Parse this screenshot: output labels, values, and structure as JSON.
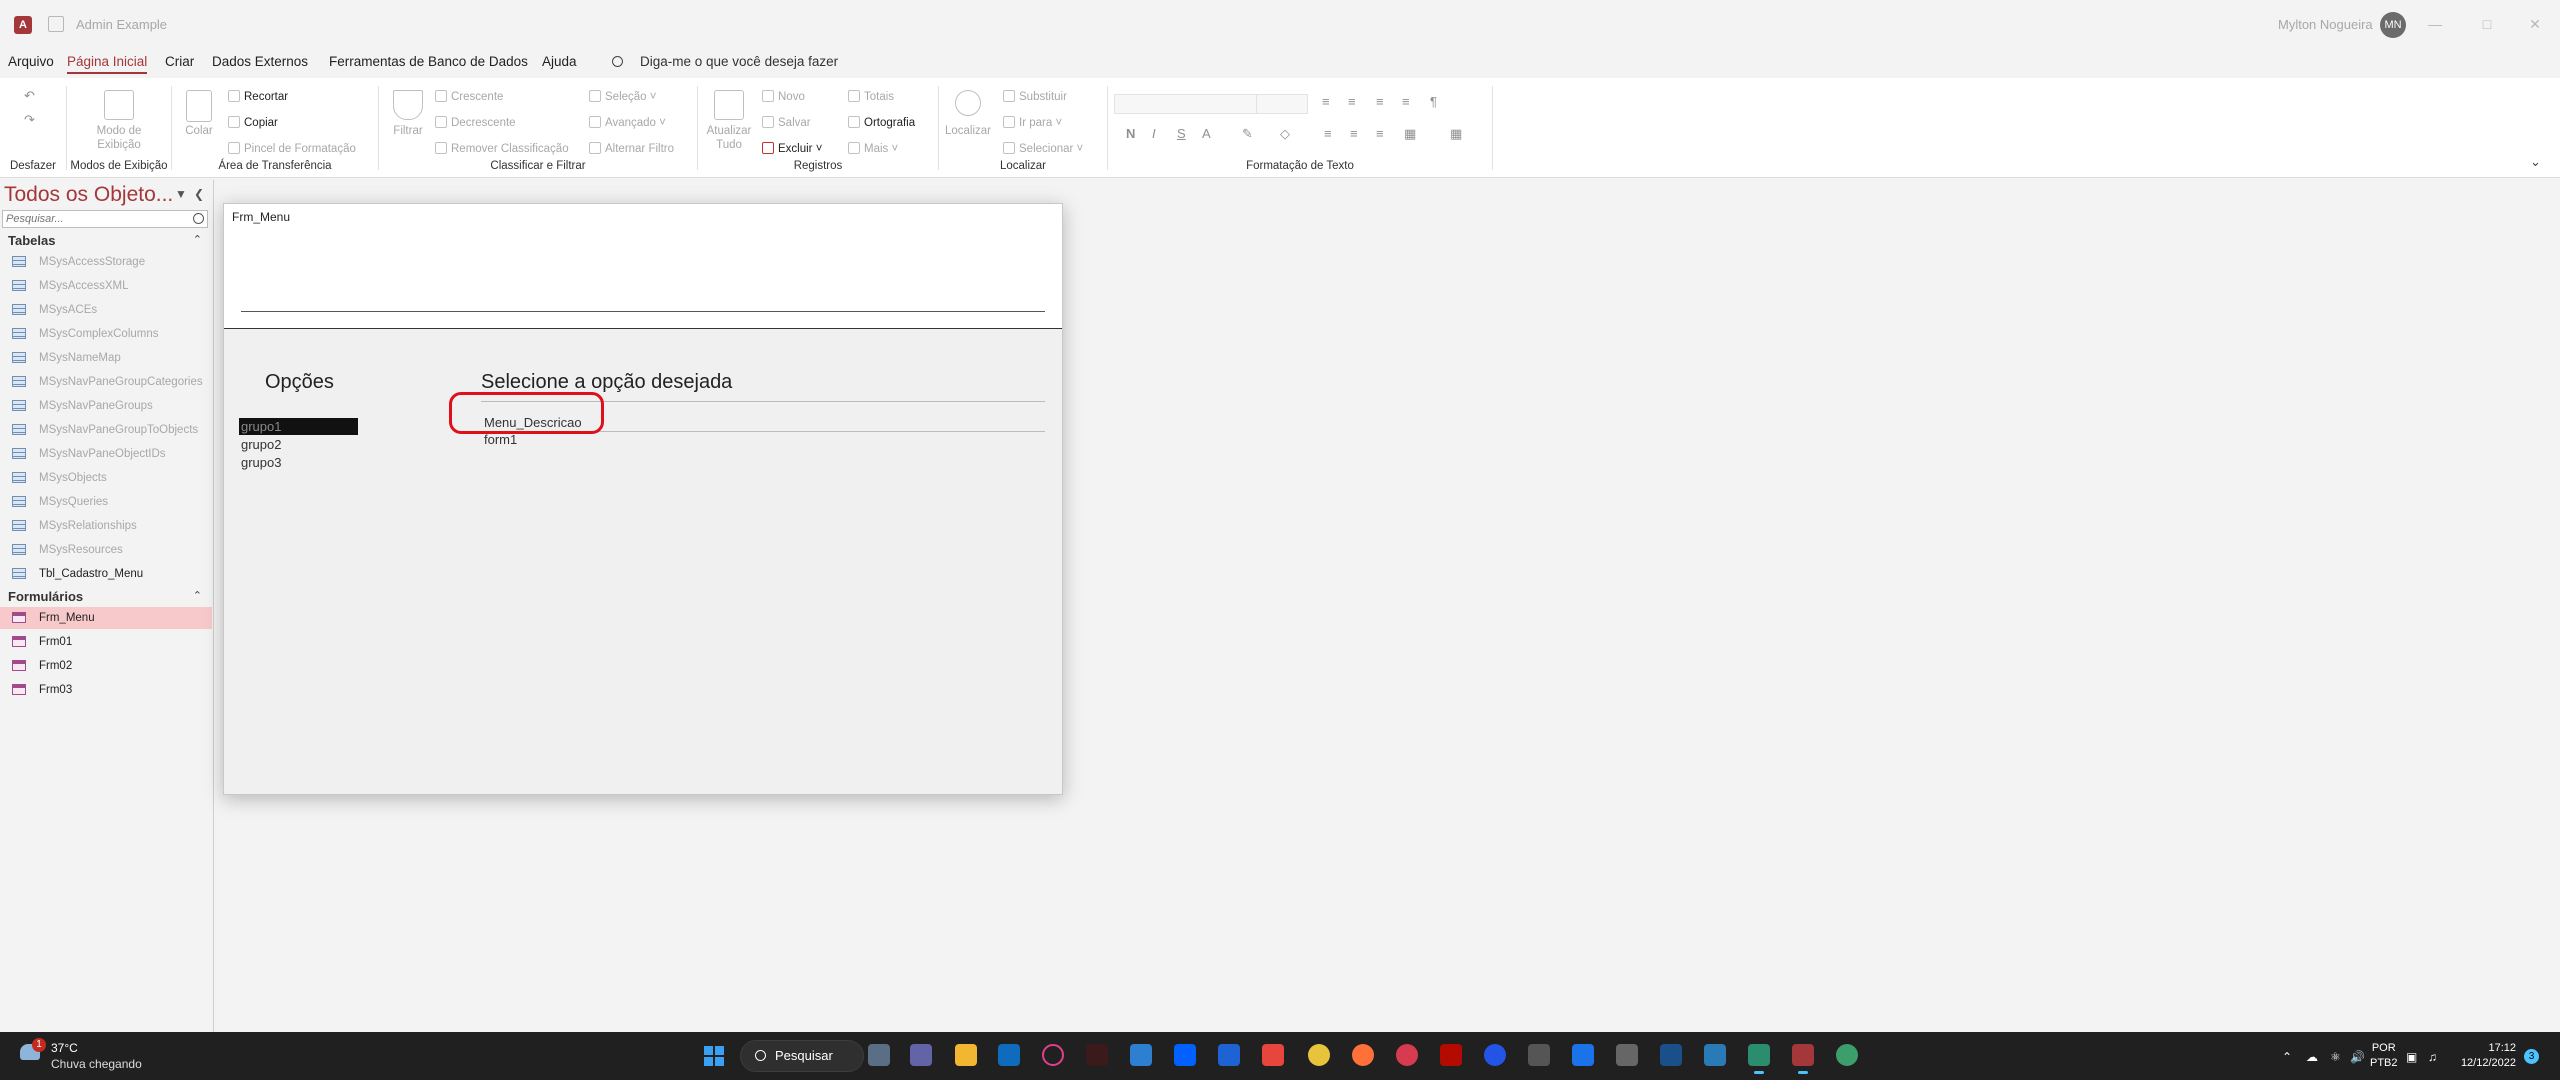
{
  "window": {
    "title": "Admin Example",
    "user_name": "Mylton Nogueira",
    "user_initials": "MN"
  },
  "menu": {
    "tabs": [
      "Arquivo",
      "Página Inicial",
      "Criar",
      "Dados Externos",
      "Ferramentas de Banco de Dados",
      "Ajuda"
    ],
    "active_tab": "Página Inicial",
    "tell_me": "Diga-me o que você deseja fazer"
  },
  "ribbon": {
    "groups": {
      "undo": "Desfazer",
      "views": "Modos de Exibição",
      "clipboard": "Área de Transferência",
      "sort_filter": "Classificar e Filtrar",
      "records": "Registros",
      "find": "Localizar",
      "text_format": "Formatação de Texto"
    },
    "view_mode": [
      "Modo de",
      "Exibição"
    ],
    "paste": "Colar",
    "cut": "Recortar",
    "copy": "Copiar",
    "format_painter": "Pincel de Formatação",
    "filter": "Filtrar",
    "ascending": "Crescente",
    "descending": "Decrescente",
    "remove_sort": "Remover Classificação",
    "selection": "Seleção",
    "advanced": "Avançado",
    "toggle_filter": "Alternar Filtro",
    "refresh": [
      "Atualizar",
      "Tudo"
    ],
    "new": "Novo",
    "save": "Salvar",
    "delete": "Excluir",
    "totals": "Totais",
    "spelling": "Ortografia",
    "more": "Mais",
    "find_btn": "Localizar",
    "replace": "Substituir",
    "goto": "Ir para",
    "select": "Selecionar",
    "bold": "N",
    "italic": "I",
    "underline": "S"
  },
  "nav": {
    "title": "Todos os Objeto...",
    "search_placeholder": "Pesquisar...",
    "sections": [
      {
        "label": "Tabelas",
        "items": [
          {
            "label": "MSysAccessStorage",
            "system": true
          },
          {
            "label": "MSysAccessXML",
            "system": true
          },
          {
            "label": "MSysACEs",
            "system": true
          },
          {
            "label": "MSysComplexColumns",
            "system": true
          },
          {
            "label": "MSysNameMap",
            "system": true
          },
          {
            "label": "MSysNavPaneGroupCategories",
            "system": true
          },
          {
            "label": "MSysNavPaneGroups",
            "system": true
          },
          {
            "label": "MSysNavPaneGroupToObjects",
            "system": true
          },
          {
            "label": "MSysNavPaneObjectIDs",
            "system": true
          },
          {
            "label": "MSysObjects",
            "system": true
          },
          {
            "label": "MSysQueries",
            "system": true
          },
          {
            "label": "MSysRelationships",
            "system": true
          },
          {
            "label": "MSysResources",
            "system": true
          },
          {
            "label": "Tbl_Cadastro_Menu",
            "system": false
          }
        ]
      },
      {
        "label": "Formulários",
        "items": [
          {
            "label": "Frm_Menu",
            "selected": true
          },
          {
            "label": "Frm01"
          },
          {
            "label": "Frm02"
          },
          {
            "label": "Frm03"
          }
        ]
      }
    ]
  },
  "form": {
    "title": "Frm_Menu",
    "options_heading": "Opções",
    "select_heading": "Selecione a opção desejada",
    "groups": [
      "grupo1",
      "grupo2",
      "grupo3"
    ],
    "selected_group": "grupo1",
    "column_header": "Menu_Descricao",
    "rows": [
      "form1"
    ]
  },
  "taskbar": {
    "temperature": "37°C",
    "condition": "Chuva chegando",
    "weather_badge": "1",
    "search": "Pesquisar",
    "lang": [
      "POR",
      "PTB2"
    ],
    "time": "17:12",
    "date": "12/12/2022",
    "notifications": "3"
  }
}
